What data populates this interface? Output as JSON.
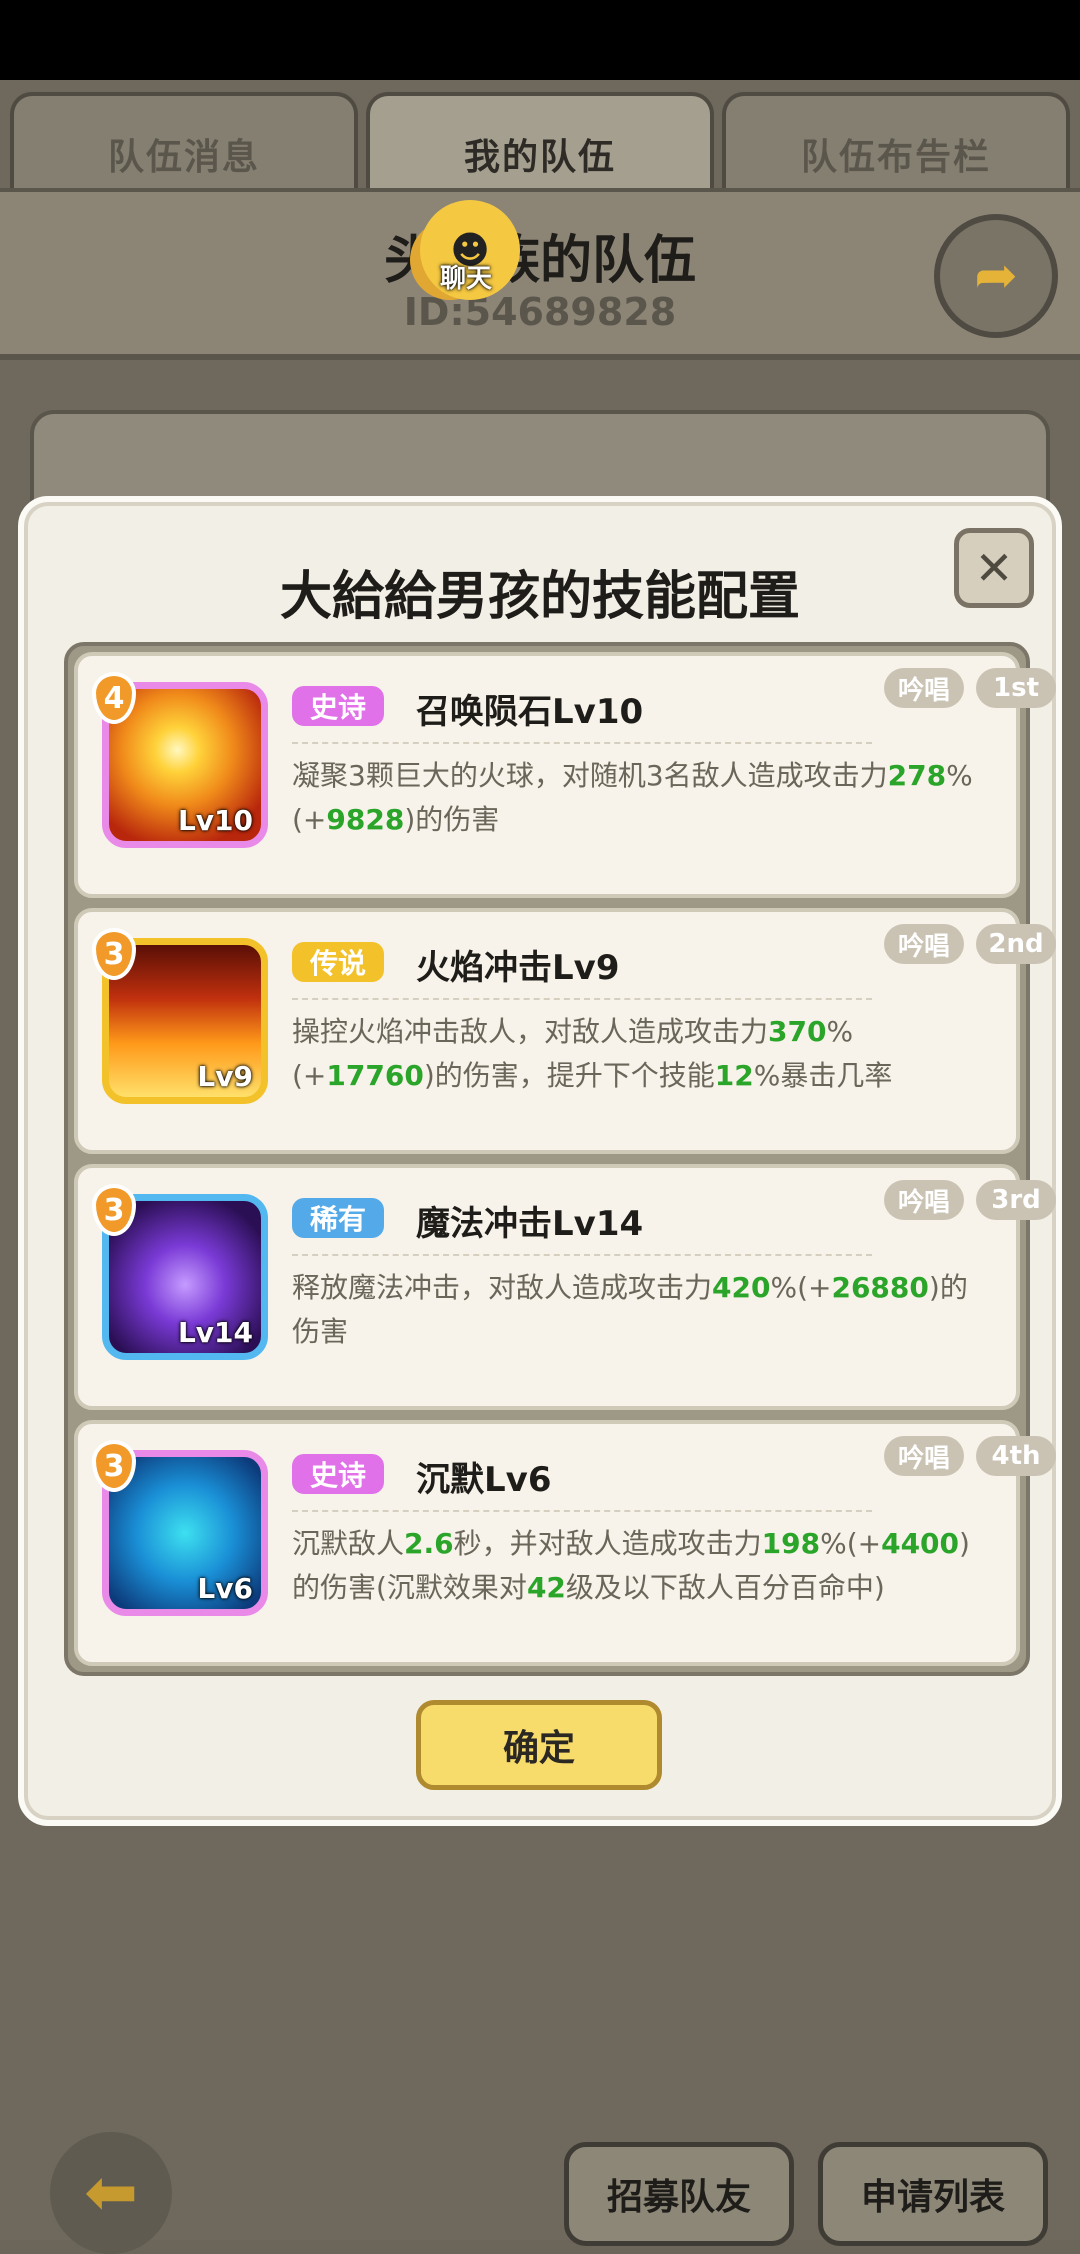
{
  "tabs": [
    "队伍消息",
    "我的队伍",
    "队伍布告栏"
  ],
  "team": {
    "name": "头铁族的队伍",
    "id": "ID:54689828"
  },
  "chat": {
    "label": "聊天"
  },
  "modal": {
    "title": "大給給男孩的技能配置",
    "confirm": "确定"
  },
  "skills": [
    {
      "rarity": "史诗",
      "name": "召唤陨石Lv10",
      "level": "Lv10",
      "badge": "4",
      "chant": "吟唱",
      "order": "1st",
      "desc": [
        "凝聚3颗巨大的火球，对随机3名敌人造成攻击力",
        "278",
        "%(+",
        "9828",
        ")的伤害"
      ]
    },
    {
      "rarity": "传说",
      "name": "火焰冲击Lv9",
      "level": "Lv9",
      "badge": "3",
      "chant": "吟唱",
      "order": "2nd",
      "desc": [
        "操控火焰冲击敌人，对敌人造成攻击力",
        "370",
        "%(+",
        "17760",
        ")的伤害，提升下个技能",
        "12",
        "%暴击几率"
      ]
    },
    {
      "rarity": "稀有",
      "name": "魔法冲击Lv14",
      "level": "Lv14",
      "badge": "3",
      "chant": "吟唱",
      "order": "3rd",
      "desc": [
        "释放魔法冲击，对敌人造成攻击力",
        "420",
        "%(+",
        "26880",
        ")的伤害"
      ]
    },
    {
      "rarity": "史诗",
      "name": "沉默Lv6",
      "level": "Lv6",
      "badge": "3",
      "chant": "吟唱",
      "order": "4th",
      "desc": [
        "沉默敌人",
        "2.6",
        "秒，并对敌人造成攻击力",
        "198",
        "%(+",
        "4400",
        ")的伤害(沉默效果对",
        "42",
        "级及以下敌人百分百命中)"
      ]
    }
  ],
  "bottom": {
    "recruit": "招募队友",
    "apply": "申请列表"
  },
  "colors": {
    "epic": "#e071e8",
    "legend": "#f3c12a",
    "rare": "#54a9e8",
    "highlight": "#2aa52a"
  },
  "icons": [
    "exit-icon",
    "close-icon",
    "back-arrow-icon",
    "chat-icon"
  ]
}
